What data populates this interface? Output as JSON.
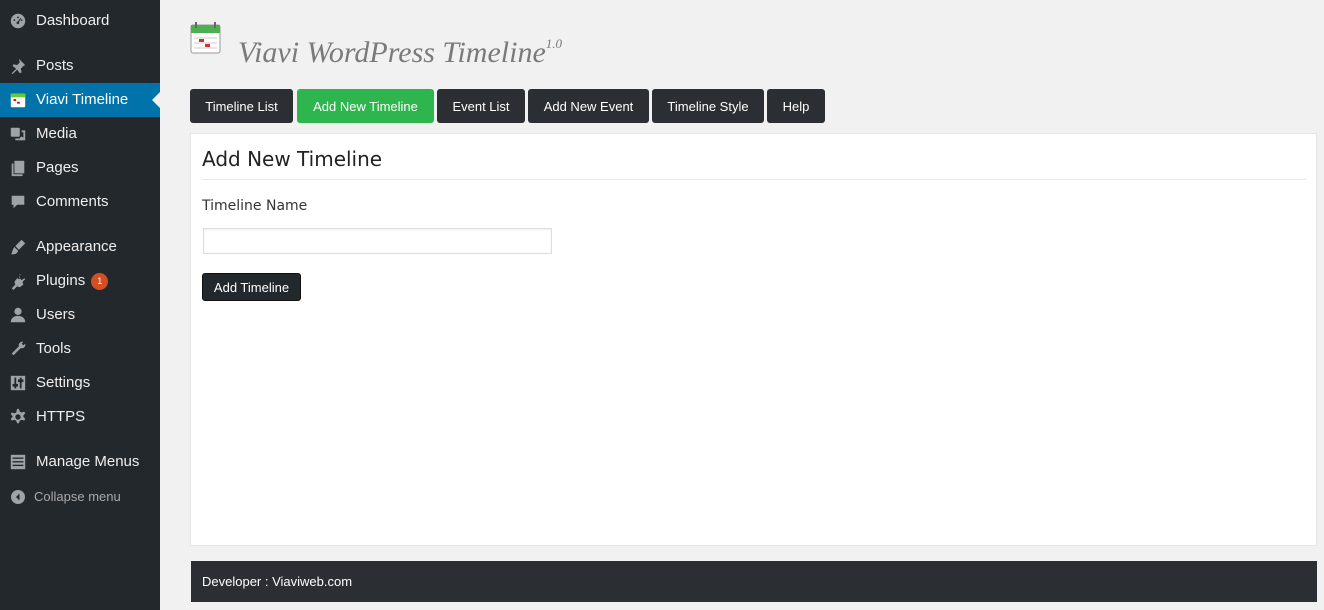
{
  "sidebar": {
    "items": [
      {
        "label": "Dashboard",
        "icon": "dashboard-icon"
      },
      {
        "label": "Posts",
        "icon": "pin-icon"
      },
      {
        "label": "Viavi Timeline",
        "icon": "calendar-icon",
        "active": true
      },
      {
        "label": "Media",
        "icon": "media-icon"
      },
      {
        "label": "Pages",
        "icon": "pages-icon"
      },
      {
        "label": "Comments",
        "icon": "comment-icon"
      },
      {
        "label": "Appearance",
        "icon": "brush-icon"
      },
      {
        "label": "Plugins",
        "icon": "plugin-icon",
        "badge": "1"
      },
      {
        "label": "Users",
        "icon": "user-icon"
      },
      {
        "label": "Tools",
        "icon": "wrench-icon"
      },
      {
        "label": "Settings",
        "icon": "settings-icon"
      },
      {
        "label": "HTTPS",
        "icon": "gear-icon"
      },
      {
        "label": "Manage Menus",
        "icon": "list-icon"
      }
    ],
    "collapse_label": "Collapse menu"
  },
  "header": {
    "title": "Viavi WordPress Timeline",
    "version": "1.0"
  },
  "tabs": [
    {
      "label": "Timeline List"
    },
    {
      "label": "Add New Timeline",
      "active": true
    },
    {
      "label": "Event List"
    },
    {
      "label": "Add New Event"
    },
    {
      "label": "Timeline Style"
    },
    {
      "label": "Help"
    }
  ],
  "form": {
    "heading": "Add New Timeline",
    "name_label": "Timeline Name",
    "name_value": "",
    "submit_label": "Add Timeline"
  },
  "footer": {
    "text": "Developer : Viaviweb.com"
  },
  "colors": {
    "sidebar_bg": "#23282d",
    "active_menu": "#0073aa",
    "active_tab": "#2fb54e",
    "tab_bg": "#2b2e33",
    "badge": "#d54e21"
  }
}
